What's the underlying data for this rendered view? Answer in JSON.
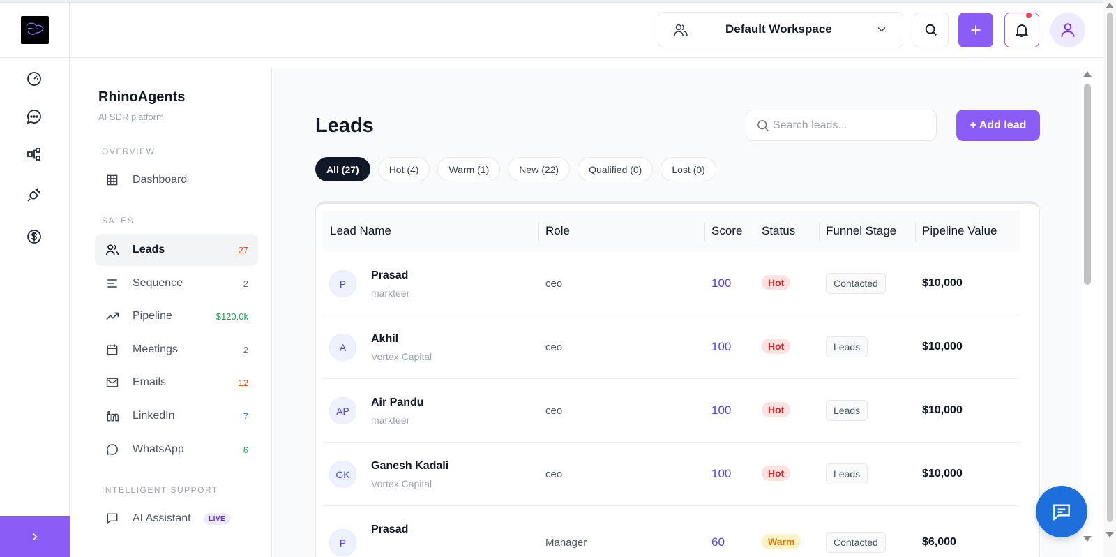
{
  "header": {
    "workspace_label": "Default Workspace"
  },
  "sidebar": {
    "brand": "RhinoAgents",
    "brand_sub": "AI SDR platform",
    "sections": {
      "overview": "OVERVIEW",
      "sales": "SALES",
      "intelligent_support": "INTELLIGENT SUPPORT"
    },
    "items": [
      {
        "label": "Dashboard",
        "count": "",
        "icon": "grid-icon"
      },
      {
        "label": "Leads",
        "count": "27",
        "icon": "users-icon",
        "count_color": "#ea580c"
      },
      {
        "label": "Sequence",
        "count": "2",
        "icon": "lines-icon",
        "count_color": "#6b7280"
      },
      {
        "label": "Pipeline",
        "count": "$120.0k",
        "icon": "trending-up-icon",
        "count_color": "#16a34a"
      },
      {
        "label": "Meetings",
        "count": "2",
        "icon": "calendar-icon",
        "count_color": "#6b7280"
      },
      {
        "label": "Emails",
        "count": "12",
        "icon": "mail-icon",
        "count_color": "#ea580c"
      },
      {
        "label": "LinkedIn",
        "count": "7",
        "icon": "linkedin-icon",
        "count_color": "#3b82f6"
      },
      {
        "label": "WhatsApp",
        "count": "6",
        "icon": "chat-bubble-icon",
        "count_color": "#16a34a"
      },
      {
        "label": "AI Assistant",
        "count": "",
        "icon": "message-square-icon"
      }
    ],
    "live_badge": "LIVE"
  },
  "main": {
    "title": "Leads",
    "search_placeholder": "Search leads...",
    "add_button": "+ Add lead",
    "filters": [
      "All (27)",
      "Hot (4)",
      "Warm (1)",
      "New (22)",
      "Qualified (0)",
      "Lost (0)"
    ],
    "columns": [
      "Lead Name",
      "Role",
      "Score",
      "Status",
      "Funnel Stage",
      "Pipeline Value"
    ],
    "rows": [
      {
        "initials": "P",
        "name": "Prasad",
        "company": "markteer",
        "role": "ceo",
        "score": "100",
        "status": "Hot",
        "stage": "Contacted",
        "value": "$10,000"
      },
      {
        "initials": "A",
        "name": "Akhil",
        "company": "Vortex Capital",
        "role": "ceo",
        "score": "100",
        "status": "Hot",
        "stage": "Leads",
        "value": "$10,000"
      },
      {
        "initials": "AP",
        "name": "Air Pandu",
        "company": "markteer",
        "role": "ceo",
        "score": "100",
        "status": "Hot",
        "stage": "Leads",
        "value": "$10,000"
      },
      {
        "initials": "GK",
        "name": "Ganesh Kadali",
        "company": "Vortex Capital",
        "role": "ceo",
        "score": "100",
        "status": "Hot",
        "stage": "Leads",
        "value": "$10,000"
      },
      {
        "initials": "P",
        "name": "Prasad",
        "company": "",
        "role": "Manager",
        "score": "60",
        "status": "Warm",
        "stage": "Contacted",
        "value": "$6,000"
      }
    ]
  },
  "colors": {
    "accent": "#8b5cf6",
    "hot": "#dc2626",
    "warm": "#d97706",
    "score": "#4f46e5",
    "chat_fab": "#1d6fdc"
  }
}
